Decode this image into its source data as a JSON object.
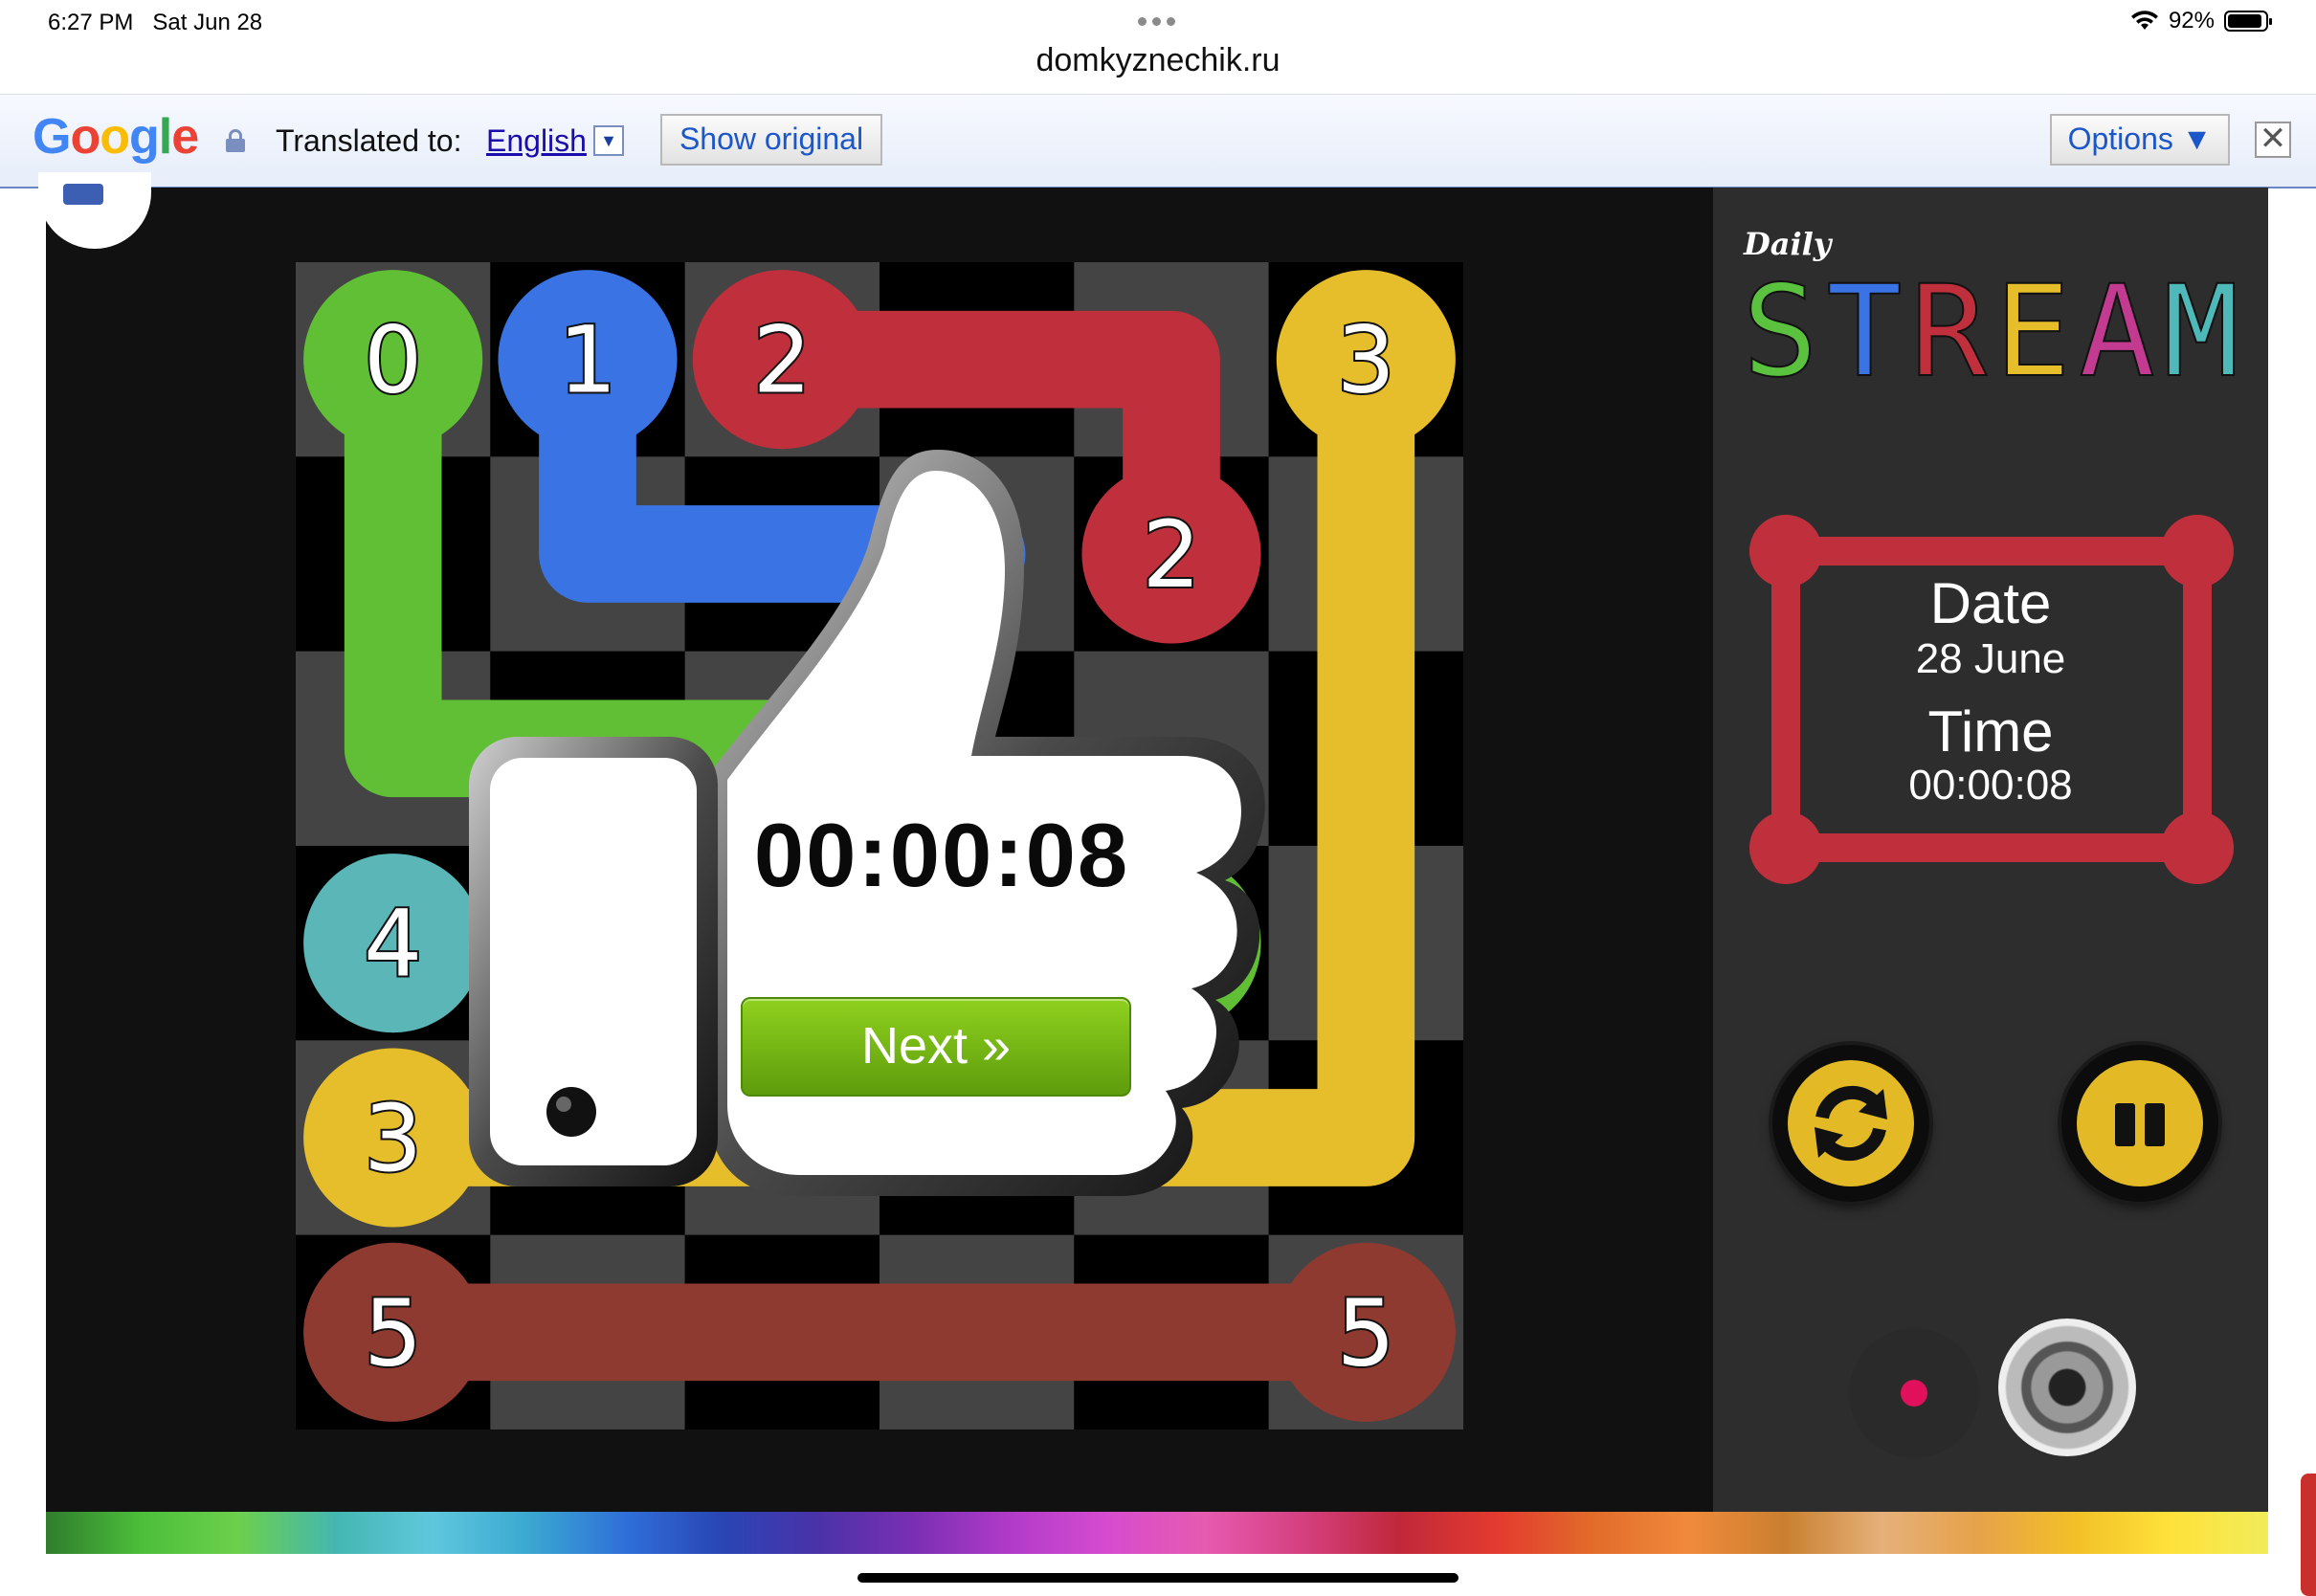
{
  "status_bar": {
    "time": "6:27 PM",
    "date": "Sat Jun 28",
    "battery": "92%",
    "battery_level": 0.92,
    "url": "domkyznechik.ru"
  },
  "translate_bar": {
    "logo": [
      "G",
      "o",
      "o",
      "g",
      "l",
      "e"
    ],
    "logo_colors": [
      "#4285f4",
      "#ea4335",
      "#fbbc05",
      "#4285f4",
      "#34a853",
      "#ea4335"
    ],
    "label": "Translated to:",
    "language": "English",
    "dropdown_arrow": "▼",
    "show_original": "Show original",
    "options": "Options ▼",
    "close": "✕"
  },
  "board": {
    "rows": 6,
    "cols": 6,
    "cells": [
      {
        "row": 0,
        "col": 0,
        "color": "green",
        "label": "0"
      },
      {
        "row": 0,
        "col": 1,
        "color": "blue",
        "label": "1"
      },
      {
        "row": 0,
        "col": 2,
        "color": "red",
        "label": "2"
      },
      {
        "row": 1,
        "col": 4,
        "color": "red",
        "label": "2"
      },
      {
        "row": 0,
        "col": 5,
        "color": "yellow",
        "label": "3"
      },
      {
        "row": 3,
        "col": 0,
        "color": "teal",
        "label": "4"
      },
      {
        "row": 4,
        "col": 0,
        "color": "yellow",
        "label": "3"
      },
      {
        "row": 5,
        "col": 0,
        "color": "brown",
        "label": "5"
      },
      {
        "row": 5,
        "col": 5,
        "color": "brown",
        "label": "5"
      },
      {
        "row": 3,
        "col": 4,
        "color": "green",
        "label": ""
      }
    ],
    "paths": [
      {
        "color": "green",
        "points": [
          [
            0,
            0
          ],
          [
            2,
            0
          ],
          [
            2,
            2
          ],
          [
            3,
            3
          ],
          [
            3,
            4
          ]
        ]
      },
      {
        "color": "blue",
        "points": [
          [
            0,
            1
          ],
          [
            1,
            1
          ],
          [
            1,
            3
          ]
        ]
      },
      {
        "color": "red",
        "points": [
          [
            0,
            2
          ],
          [
            0,
            4
          ],
          [
            1,
            4
          ]
        ]
      },
      {
        "color": "yellow",
        "points": [
          [
            0,
            5
          ],
          [
            4,
            5
          ],
          [
            4,
            0
          ]
        ]
      },
      {
        "color": "brown",
        "points": [
          [
            5,
            0
          ],
          [
            5,
            5
          ]
        ]
      }
    ],
    "colors": {
      "green": "#60bf35",
      "blue": "#3a74e4",
      "red": "#c0303c",
      "yellow": "#e6bd2a",
      "teal": "#5bb6b8",
      "brown": "#8e3a30"
    }
  },
  "result": {
    "time": "00:00:08",
    "next_button": "Next »"
  },
  "sidebar": {
    "logo_small": "Daily",
    "logo_letters": [
      "S",
      "T",
      "R",
      "E",
      "A",
      "M"
    ],
    "logo_colors": [
      "#5bc23f",
      "#3a74e4",
      "#c0303c",
      "#e6bd2a",
      "#c23b91",
      "#4fb9b9"
    ],
    "date_label": "Date",
    "date_value": "28 June",
    "time_label": "Time",
    "time_value": "00:00:08",
    "frame_color": "#c0303c",
    "control_color": "#e3ba26"
  }
}
